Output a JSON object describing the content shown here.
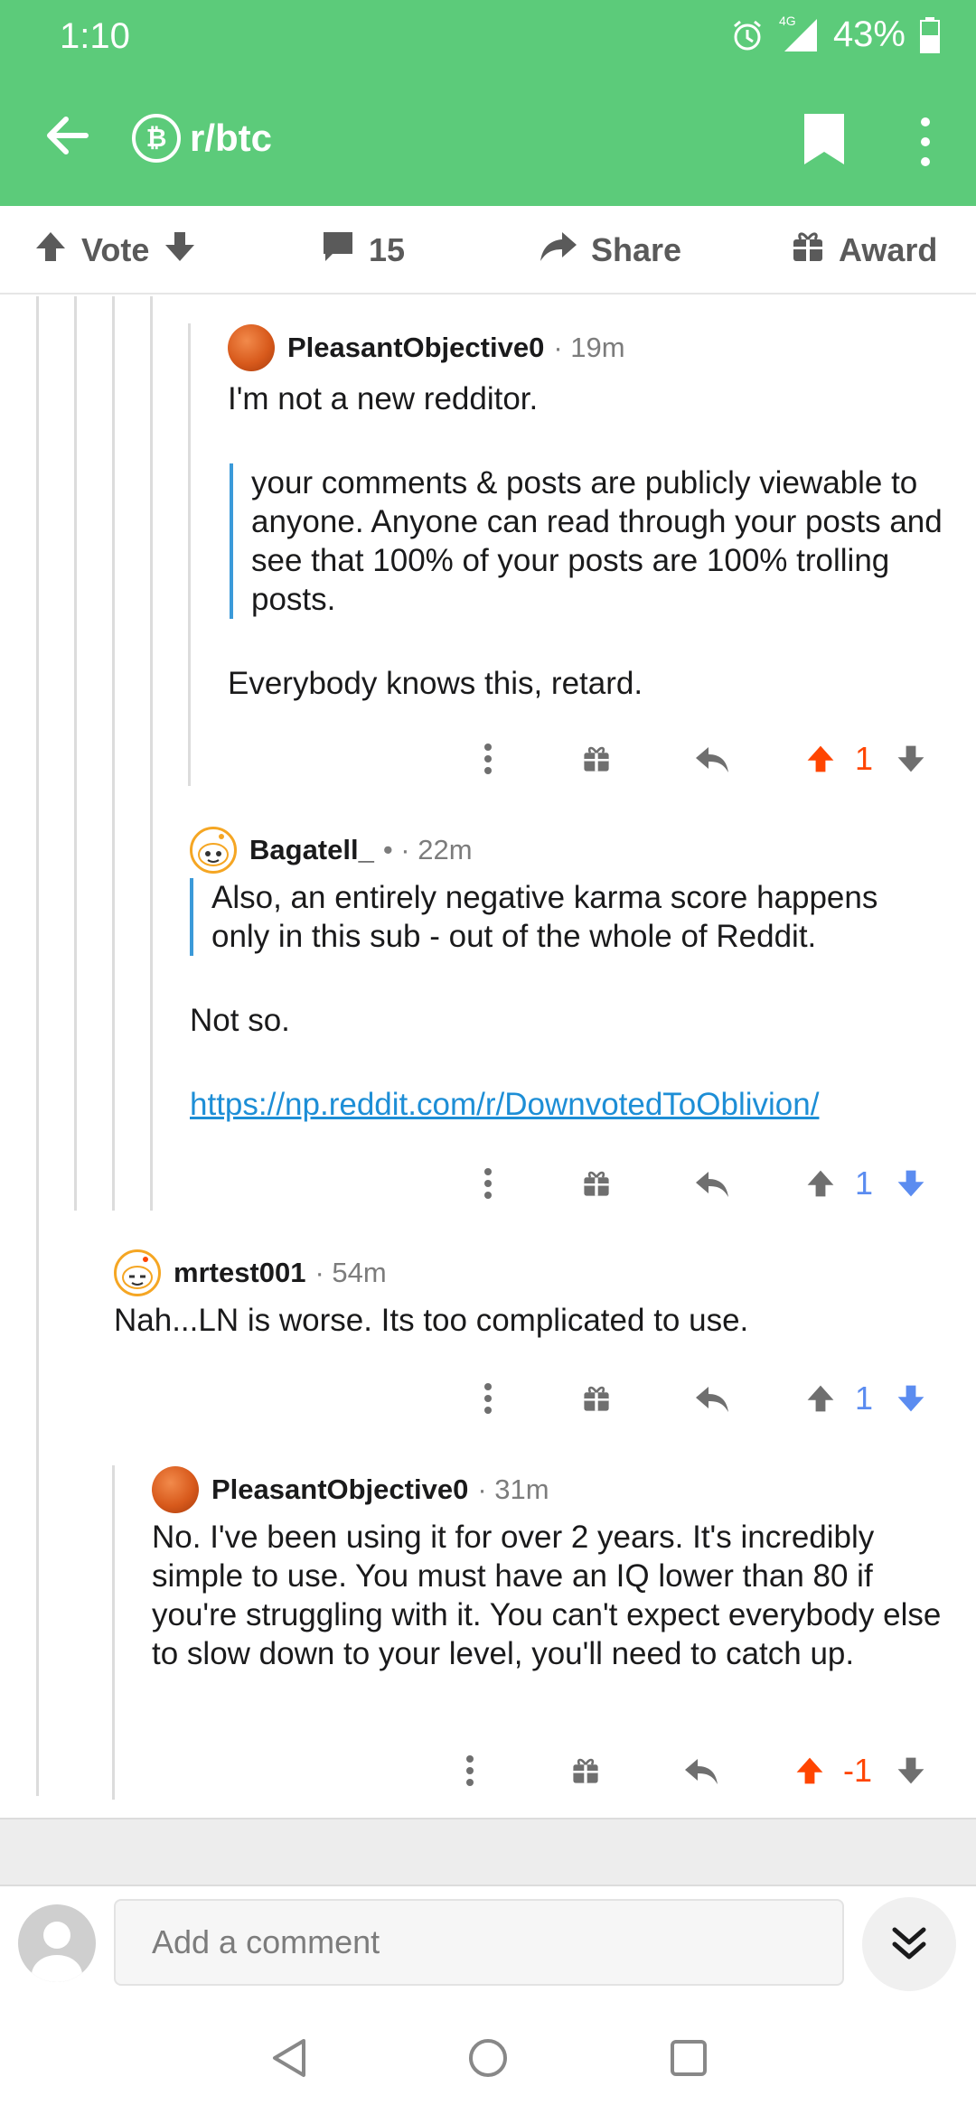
{
  "status_bar": {
    "time": "1:10",
    "network": "4G",
    "battery": "43%"
  },
  "header": {
    "subreddit": "r/btc",
    "sub_icon": "bitcoin-icon"
  },
  "action_bar": {
    "vote_label": "Vote",
    "comment_count": "15",
    "share_label": "Share",
    "award_label": "Award"
  },
  "comments": [
    {
      "user": "PleasantObjective0",
      "meta": "· 19m",
      "text": "I'm not a new redditor.",
      "quote": "your comments & posts are publicly viewable to anyone. Anyone can read through your posts and see that 100% of your posts are 100% trolling posts.",
      "text2": "Everybody knows this, retard.",
      "score": "1",
      "vote_state": "up"
    },
    {
      "user": "Bagatell_",
      "meta": "• · 22m",
      "quote": "Also, an entirely negative karma score happens only in this sub - out of the whole of Reddit.",
      "text": "Not so.",
      "link": "https://np.reddit.com/r/DownvotedToOblivion/",
      "score": "1",
      "vote_state": "down"
    },
    {
      "user": "mrtest001",
      "meta": "· 54m",
      "text": "Nah...LN is worse.  Its too complicated to use.",
      "score": "1",
      "vote_state": "down"
    },
    {
      "user": "PleasantObjective0",
      "meta": "· 31m",
      "text": "No.  I've been using it for over 2 years.  It's incredibly simple to use.  You must have an IQ lower than 80 if you're struggling with it.  You can't expect everybody else to slow down to your level, you'll need to catch up.",
      "score": "-1",
      "vote_state": "up"
    }
  ],
  "composer": {
    "placeholder": "Add a comment"
  },
  "colors": {
    "header_green": "#5ccb7a",
    "upvote": "#ff4500",
    "downvote": "#5b8cf0",
    "link": "#1d8ed6",
    "quote_bar": "#3b9ad9"
  }
}
